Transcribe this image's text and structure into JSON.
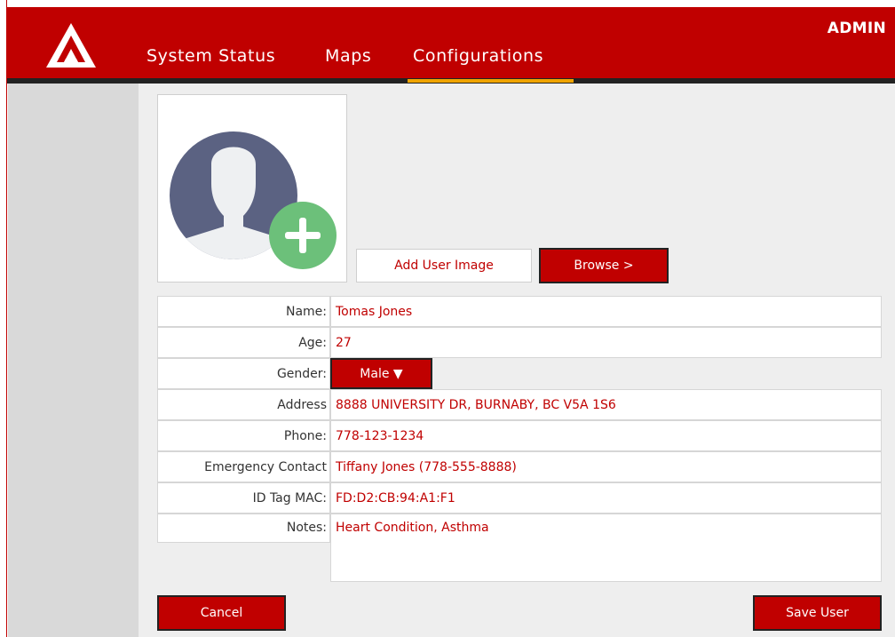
{
  "header": {
    "user_role": "ADMIN",
    "nav": [
      {
        "label": "System Status"
      },
      {
        "label": "Maps"
      },
      {
        "label": "Configurations"
      }
    ],
    "active_tab": "Configurations"
  },
  "photo": {
    "add_image_label": "Add User Image",
    "browse_label": "Browse >"
  },
  "form": {
    "name": {
      "label": "Name:",
      "value": "Tomas Jones"
    },
    "age": {
      "label": "Age:",
      "value": "27"
    },
    "gender": {
      "label": "Gender:",
      "value": "Male ▼"
    },
    "address": {
      "label": "Address",
      "value": "8888 UNIVERSITY DR, BURNABY, BC V5A 1S6"
    },
    "phone": {
      "label": "Phone:",
      "value": "778-123-1234"
    },
    "emergency": {
      "label": "Emergency Contact",
      "value": "Tiffany Jones (778-555-8888)"
    },
    "id_tag": {
      "label": "ID Tag MAC:",
      "value": "FD:D2:CB:94:A1:F1"
    },
    "notes": {
      "label": "Notes:",
      "value": "Heart Condition, Asthma"
    }
  },
  "actions": {
    "cancel_label": "Cancel",
    "save_label": "Save User"
  },
  "colors": {
    "brand": "#c00000",
    "tab_underline": "#f0a400",
    "avatar_bg": "#5b6282",
    "add_icon": "#6cc07a"
  },
  "icons": {
    "logo": "triangle-a-logo",
    "avatar": "user-silhouette-icon",
    "add": "plus-circle-icon"
  }
}
